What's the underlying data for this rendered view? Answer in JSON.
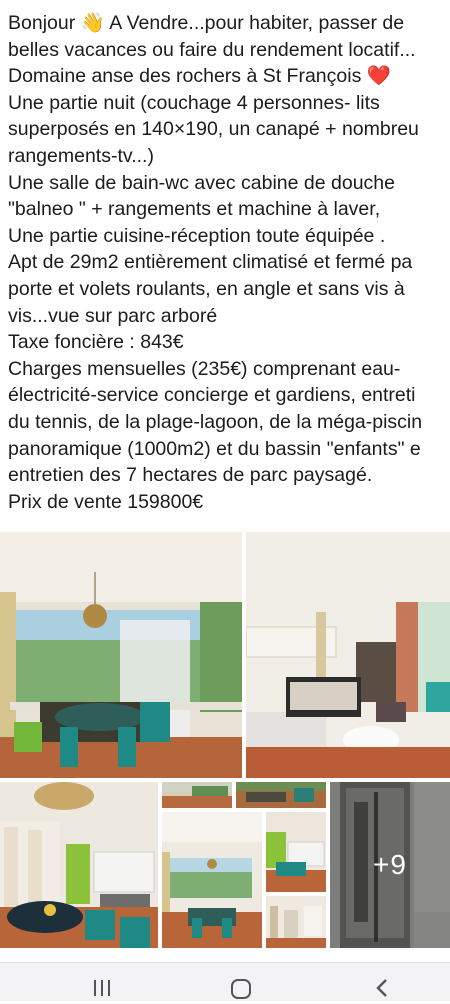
{
  "post": {
    "lines": [
      "Bonjour 👋 A Vendre...pour habiter, passer de",
      "belles vacances ou faire du rendement locatif...",
      "Domaine anse des rochers à St François ❤️",
      "Une partie nuit (couchage 4 personnes- lits",
      "superposés en 140×190, un canapé + nombreu",
      "rangements-tv...)",
      "Une salle de bain-wc avec cabine de douche",
      "\"balneo \" + rangements et machine à laver,",
      "Une partie cuisine-réception toute équipée .",
      "Apt  de 29m2 entièrement climatisé et fermé pa",
      "porte et volets roulants, en angle et sans vis à",
      "vis...vue sur parc arboré",
      "Taxe foncière : 843€",
      "Charges mensuelles (235€) comprenant eau-",
      "électricité-service concierge et gardiens, entreti",
      "du tennis, de la plage-lagoon, de la méga-piscin",
      "panoramique (1000m2) et du bassin \"enfants\" e",
      "entretien des 7 hectares de parc paysagé.",
      "Prix de vente 159800€"
    ]
  },
  "gallery": {
    "more_count": "+9",
    "photos": [
      "veranda-dining",
      "bunk-bedroom",
      "kitchen-living",
      "terrace-thumb",
      "balcony-thumb",
      "dining-thumb",
      "shower-cabin"
    ]
  },
  "navbar": {
    "icons": [
      "recent-apps-icon",
      "home-icon",
      "back-icon"
    ]
  }
}
